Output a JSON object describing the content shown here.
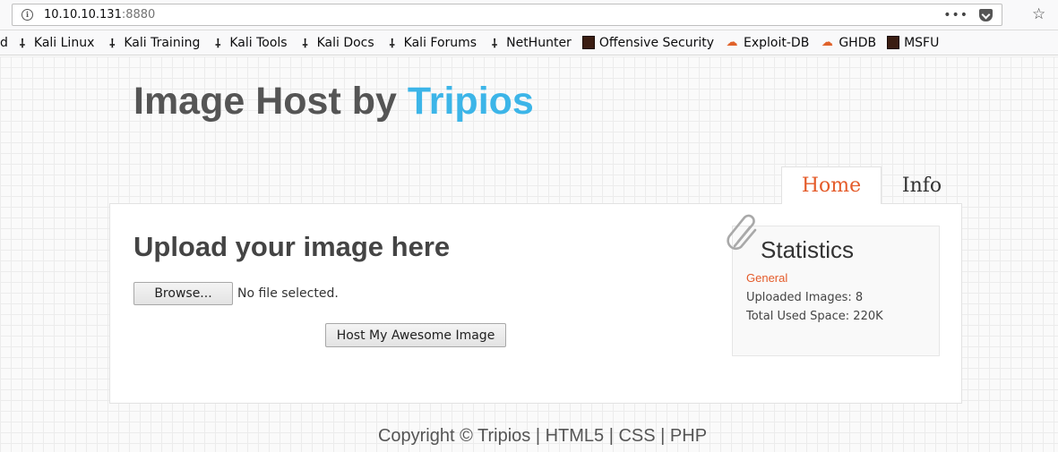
{
  "browser": {
    "url_host": "10.10.10.131",
    "url_port": ":8880",
    "menu_dots": "•••",
    "star": "☆",
    "bookmarks": [
      {
        "label": "d",
        "icon": "none"
      },
      {
        "label": "Kali Linux",
        "icon": "kali-dragon-icon"
      },
      {
        "label": "Kali Training",
        "icon": "kali-dragon-icon"
      },
      {
        "label": "Kali Tools",
        "icon": "kali-dragon-icon"
      },
      {
        "label": "Kali Docs",
        "icon": "kali-dragon-icon"
      },
      {
        "label": "Kali Forums",
        "icon": "kali-dragon-icon"
      },
      {
        "label": "NetHunter",
        "icon": "kali-dragon-icon"
      },
      {
        "label": "Offensive Security",
        "icon": "offsec-icon"
      },
      {
        "label": "Exploit-DB",
        "icon": "exploitdb-icon"
      },
      {
        "label": "GHDB",
        "icon": "exploitdb-icon"
      },
      {
        "label": "MSFU",
        "icon": "offsec-icon"
      }
    ]
  },
  "site": {
    "title_prefix": "Image Host by ",
    "title_brand": "Tripios",
    "brand_color": "#3cb5e8",
    "accent_color": "#e45b2a"
  },
  "tabs": {
    "home": "Home",
    "info": "Info"
  },
  "upload": {
    "title": "Upload your image here",
    "browse_label": "Browse...",
    "file_status": "No file selected.",
    "submit_label": "Host My Awesome Image"
  },
  "stats": {
    "title": "Statistics",
    "subtitle": "General",
    "uploaded_images": "Uploaded Images: 8",
    "total_space": "Total Used Space: 220K"
  },
  "footer": {
    "text": "Copyright © Tripios | HTML5 | CSS | PHP"
  }
}
